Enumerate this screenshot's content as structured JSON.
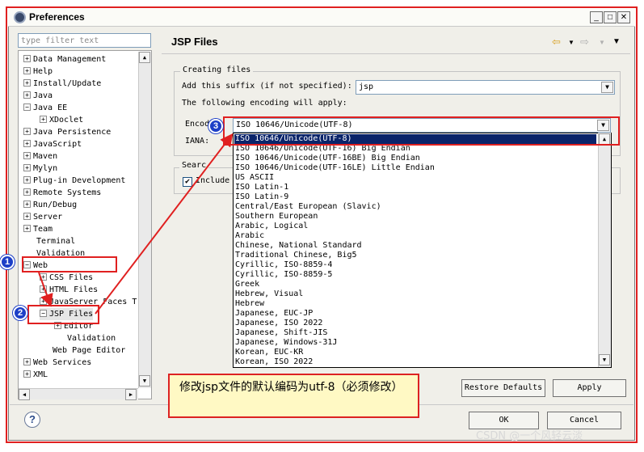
{
  "window": {
    "title": "Preferences",
    "min_label": "_",
    "max_label": "□",
    "close_label": "✕"
  },
  "filter": {
    "placeholder": "type filter text"
  },
  "tree": {
    "items": [
      {
        "label": "Data Management",
        "expander": "+"
      },
      {
        "label": "Help",
        "expander": "+"
      },
      {
        "label": "Install/Update",
        "expander": "+"
      },
      {
        "label": "Java",
        "expander": "+"
      },
      {
        "label": "Java EE",
        "expander": "−"
      },
      {
        "label": "XDoclet",
        "expander": "+"
      },
      {
        "label": "Java Persistence",
        "expander": "+"
      },
      {
        "label": "JavaScript",
        "expander": "+"
      },
      {
        "label": "Maven",
        "expander": "+"
      },
      {
        "label": "Mylyn",
        "expander": "+"
      },
      {
        "label": "Plug-in Development",
        "expander": "+"
      },
      {
        "label": "Remote Systems",
        "expander": "+"
      },
      {
        "label": "Run/Debug",
        "expander": "+"
      },
      {
        "label": "Server",
        "expander": "+"
      },
      {
        "label": "Team",
        "expander": "+"
      },
      {
        "label": "Terminal",
        "expander": ""
      },
      {
        "label": "Validation",
        "expander": ""
      },
      {
        "label": "Web",
        "expander": "−"
      },
      {
        "label": "CSS Files",
        "expander": "+"
      },
      {
        "label": "HTML Files",
        "expander": "+"
      },
      {
        "label": "JavaServer Faces T",
        "expander": "+"
      },
      {
        "label": "JSP Files",
        "expander": "−"
      },
      {
        "label": "Editor",
        "expander": "+"
      },
      {
        "label": "Validation",
        "expander": ""
      },
      {
        "label": "Web Page Editor",
        "expander": ""
      },
      {
        "label": "Web Services",
        "expander": "+"
      },
      {
        "label": "XML",
        "expander": "+"
      }
    ]
  },
  "page": {
    "title": "JSP Files",
    "creating_group": "Creating files",
    "suffix_label": "Add this suffix (if not specified):",
    "suffix_value": "jsp",
    "encoding_note": "The following encoding will apply:",
    "encoding_label": "Encod",
    "iana_label": "IANA:",
    "search_group": "Searc",
    "include_label": "Include"
  },
  "encoding": {
    "selected": "ISO 10646/Unicode(UTF-8)",
    "options": [
      "ISO 10646/Unicode(UTF-8)",
      "ISO 10646/Unicode(UTF-16) Big Endian",
      "ISO 10646/Unicode(UTF-16BE) Big Endian",
      "ISO 10646/Unicode(UTF-16LE) Little Endian",
      "US ASCII",
      "ISO Latin-1",
      "ISO Latin-9",
      "Central/East European (Slavic)",
      "Southern European",
      "Arabic, Logical",
      "Arabic",
      "Chinese, National Standard",
      "Traditional Chinese, Big5",
      "Cyrillic, ISO-8859-4",
      "Cyrillic, ISO-8859-5",
      "Greek",
      "Hebrew, Visual",
      "Hebrew",
      "Japanese, EUC-JP",
      "Japanese, ISO 2022",
      "Japanese, Shift-JIS",
      "Japanese, Windows-31J",
      "Korean, EUC-KR",
      "Korean, ISO 2022"
    ]
  },
  "buttons": {
    "restore": "Restore Defaults",
    "apply": "Apply",
    "ok": "OK",
    "cancel": "Cancel"
  },
  "annotations": {
    "badge1": "1",
    "badge2": "2",
    "badge3": "3",
    "note": "修改jsp文件的默认编码为utf-8（必须修改）"
  },
  "watermark": "CSDN @一个风轻云淡",
  "icons": {
    "back": "back-arrow-icon",
    "forward": "forward-arrow-icon",
    "menu": "view-menu-icon",
    "help": "help-icon"
  },
  "colors": {
    "highlight_red": "#e02020",
    "badge_blue": "#1d3fc7",
    "selection_blue": "#0a246a",
    "note_bg": "#fff9c4"
  }
}
